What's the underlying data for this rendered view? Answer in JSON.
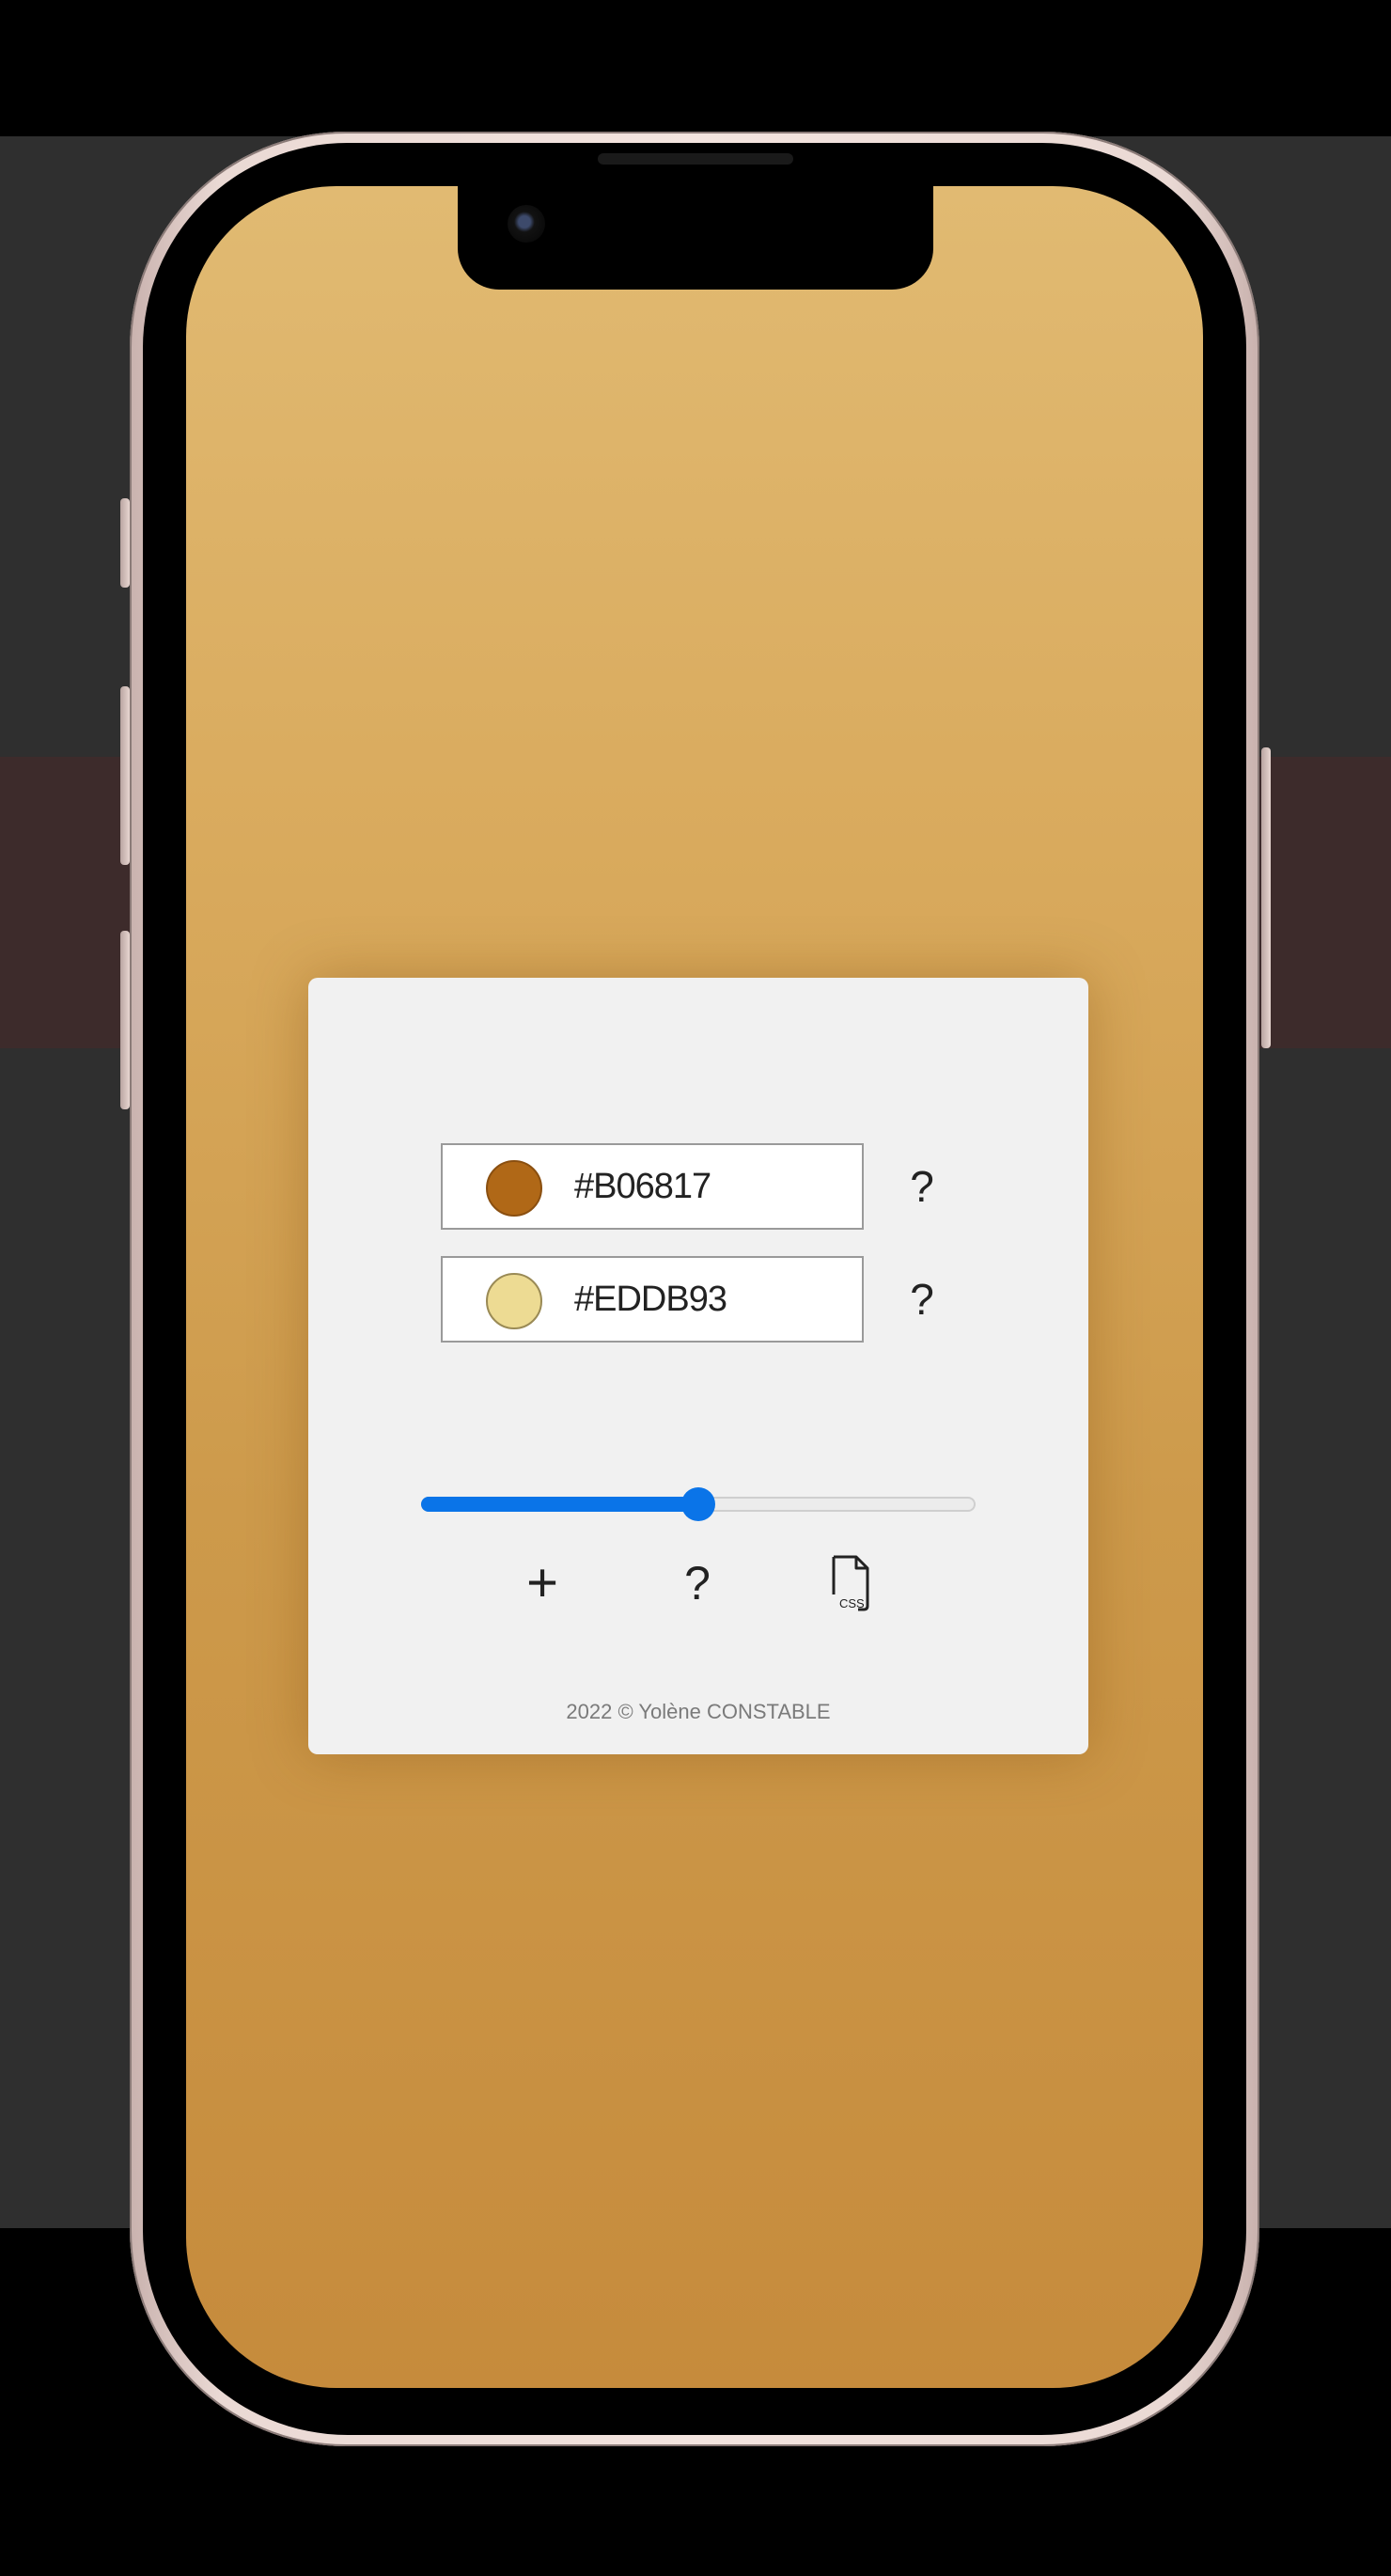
{
  "colors": [
    {
      "hex": "#B06817",
      "swatch": "#B06817",
      "help": "?"
    },
    {
      "hex": "#EDDB93",
      "swatch": "#EDDB93",
      "help": "?"
    }
  ],
  "slider": {
    "value": 0.5
  },
  "actions": {
    "add_label": "+",
    "help_label": "?",
    "css_icon_text": "CSS"
  },
  "footer": {
    "text": "2022 © Yolène CONSTABLE"
  },
  "theme": {
    "accent": "#0a74e8",
    "gradient_top": "#e1ba72",
    "gradient_bottom": "#c68b3c",
    "card_bg": "#f1f1f1"
  }
}
